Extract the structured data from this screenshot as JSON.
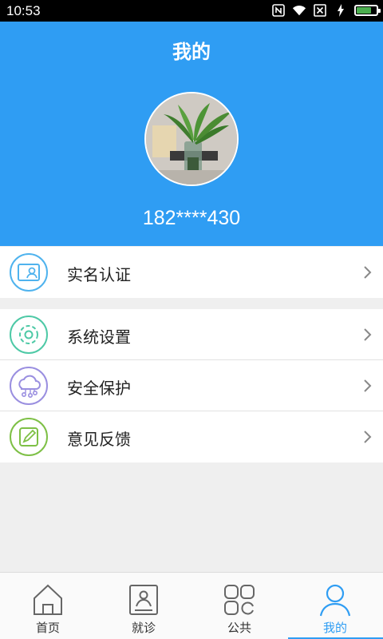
{
  "status_bar": {
    "time": "10:53",
    "icons": [
      "nfc-icon",
      "wifi-icon",
      "sim-x-icon",
      "charging-icon",
      "battery-icon"
    ],
    "battery_level": 0.75,
    "battery_color": "#4caf50"
  },
  "header": {
    "title": "我的",
    "phone": "182****430",
    "background": "#2f9df3"
  },
  "menu_groups": [
    [
      {
        "label": "实名认证",
        "icon": "id-card-icon",
        "color": "#4fb3ee"
      }
    ],
    [
      {
        "label": "系统设置",
        "icon": "gear-icon",
        "color": "#4ec9a6"
      },
      {
        "label": "安全保护",
        "icon": "cloud-network-icon",
        "color": "#9a8fe0"
      },
      {
        "label": "意见反馈",
        "icon": "edit-icon",
        "color": "#7ec046"
      }
    ]
  ],
  "tab_bar": {
    "tabs": [
      {
        "label": "首页",
        "icon": "home-icon"
      },
      {
        "label": "就诊",
        "icon": "medical-card-icon"
      },
      {
        "label": "公共",
        "icon": "grid-icon"
      },
      {
        "label": "我的",
        "icon": "user-icon"
      }
    ],
    "active_index": 3,
    "active_color": "#2f9df3"
  }
}
